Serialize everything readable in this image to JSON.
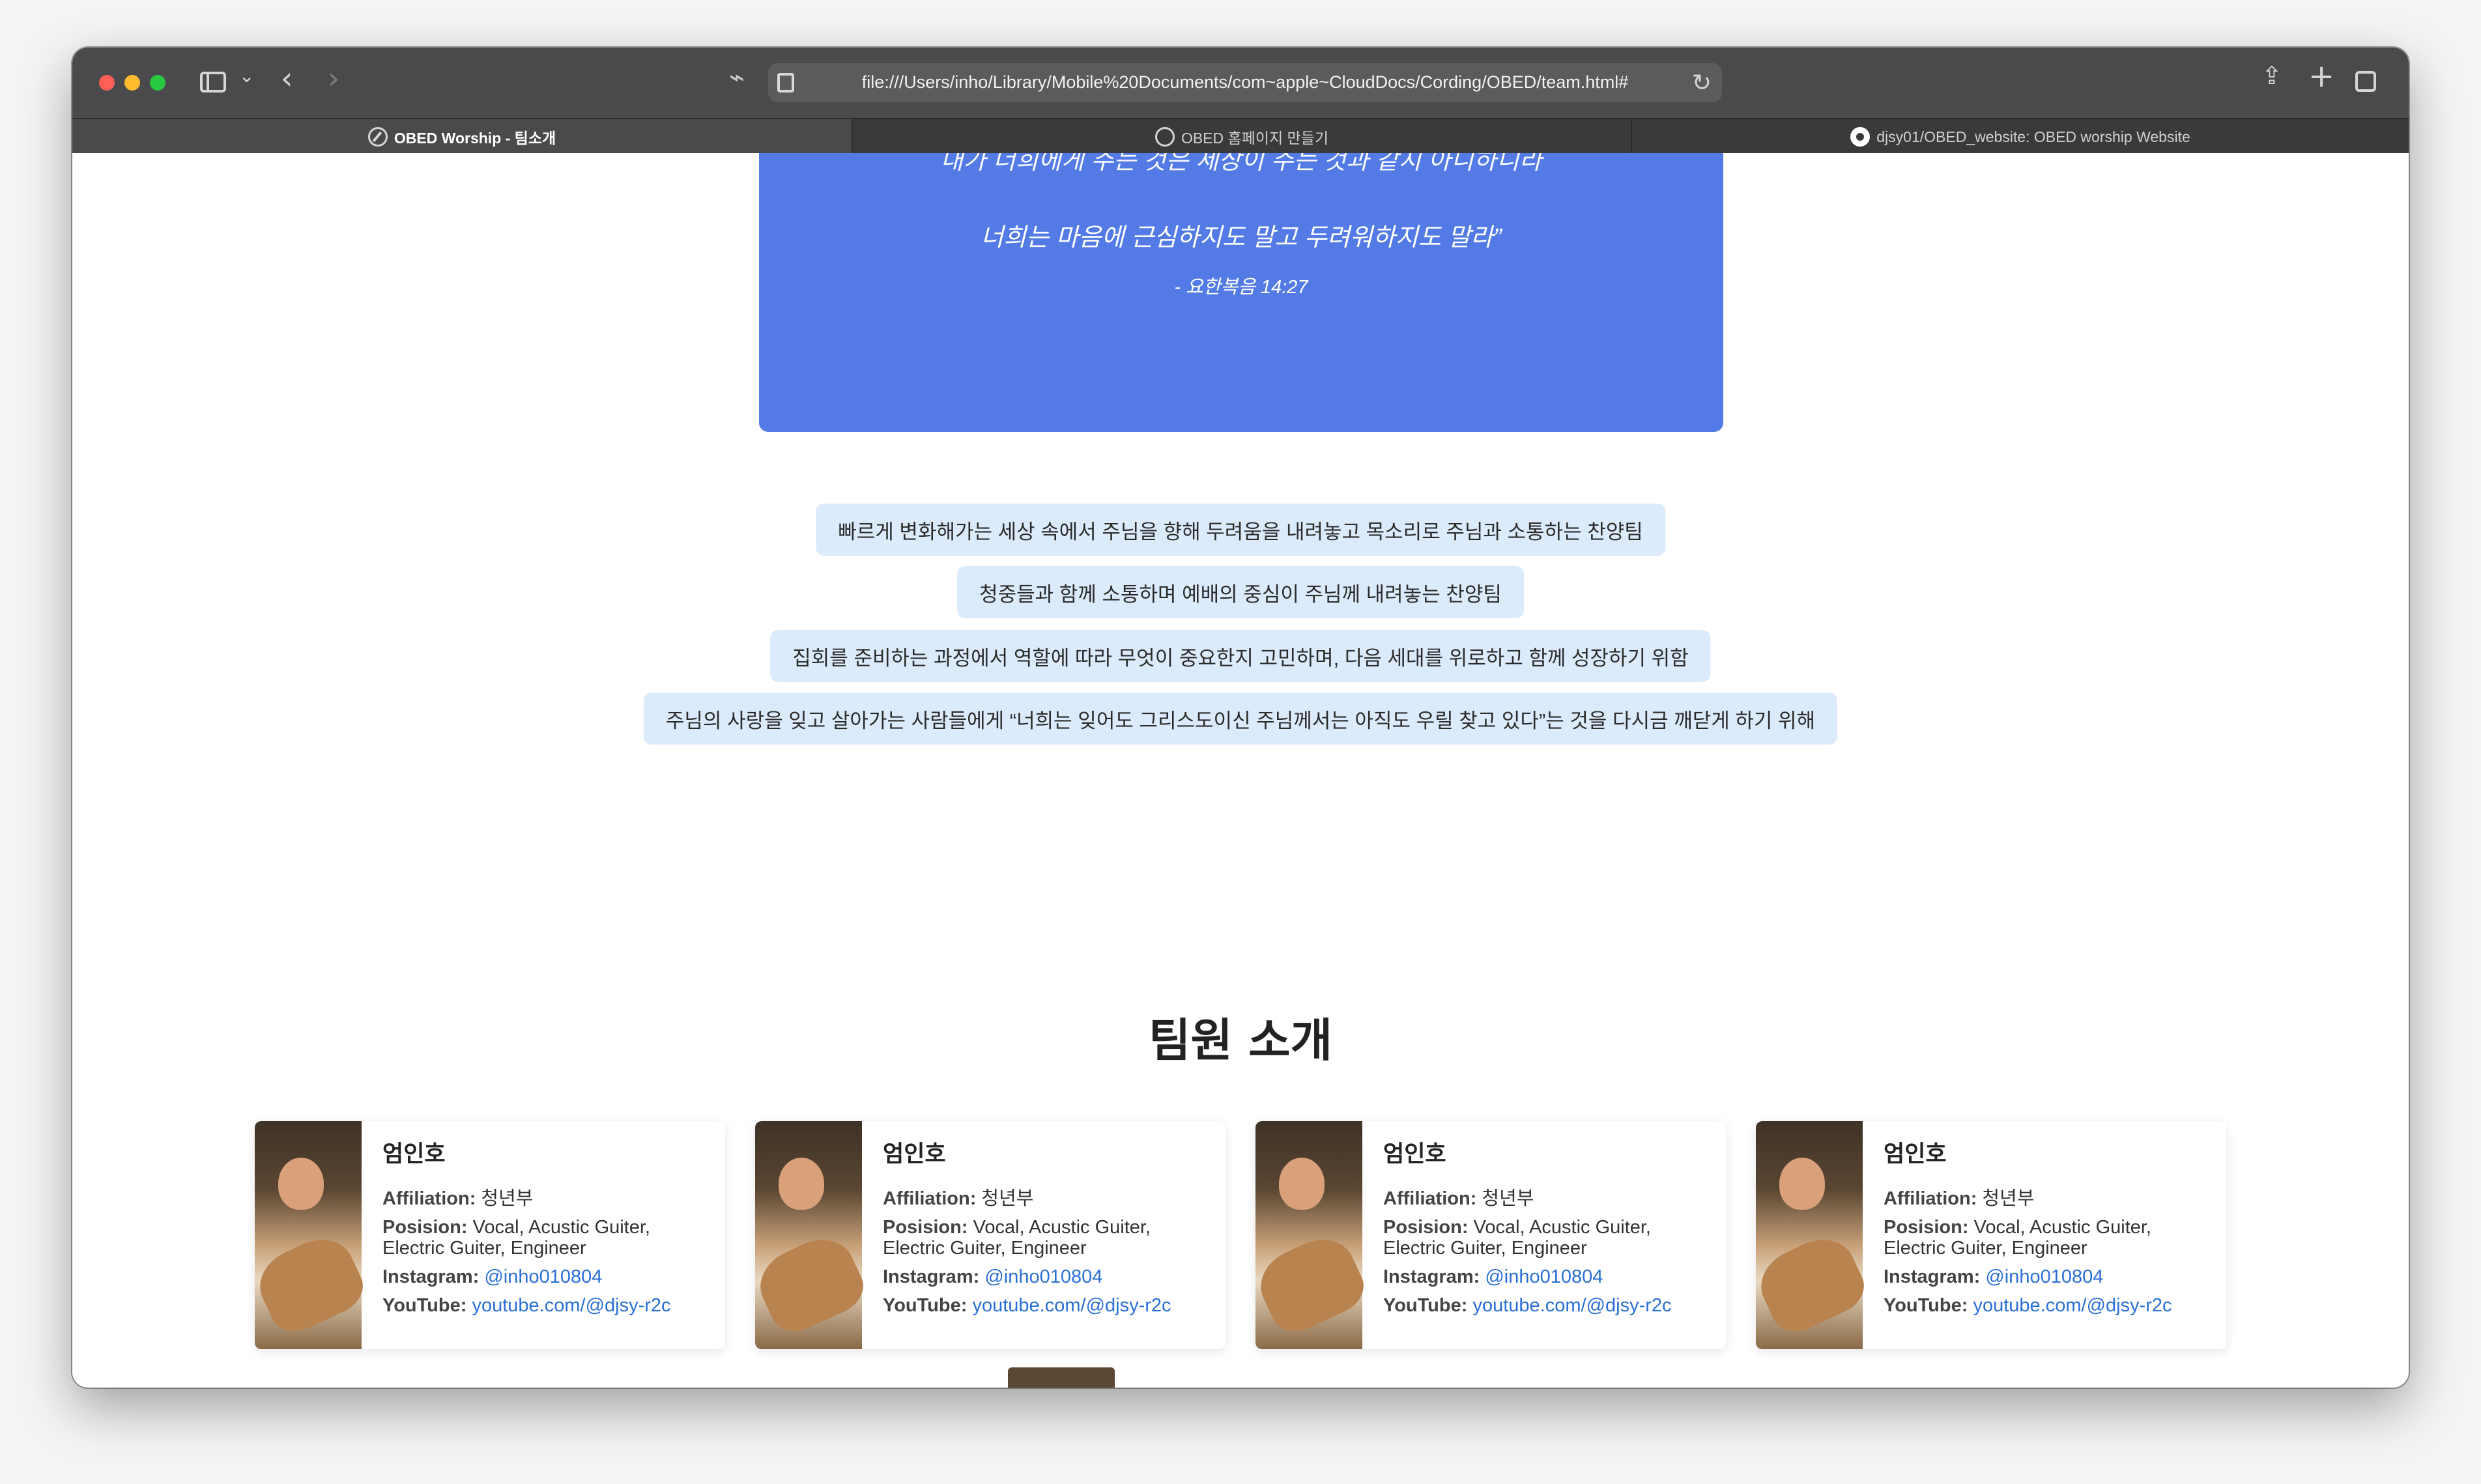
{
  "browser": {
    "url": "file:///Users/inho/Library/Mobile%20Documents/com~apple~CloudDocs/Cording/OBED/team.html#",
    "tabs": [
      {
        "label": "OBED Worship - 팀소개",
        "active": true
      },
      {
        "label": "OBED 홈페이지 만들기",
        "active": false
      },
      {
        "label": "djsy01/OBED_website: OBED worship Website",
        "active": false
      }
    ]
  },
  "verse": {
    "line1": "내가 너희에게 주는 것은 세상이 주는 것과 같지 아니하니라",
    "line2": "너희는 마음에 근심하지도 말고 두려워하지도 말라”",
    "reference": "- 요한복음 14:27"
  },
  "mission": [
    "빠르게 변화해가는 세상 속에서 주님을 향해 두려움을 내려놓고 목소리로 주님과 소통하는 찬양팀",
    "청중들과 함께 소통하며 예배의 중심이 주님께 내려놓는 찬양팀",
    "집회를 준비하는 과정에서 역할에 따라 무엇이 중요한지 고민하며, 다음 세대를 위로하고 함께 성장하기 위함",
    "주님의 사랑을 잊고 살아가는 사람들에게 “너희는 잊어도 그리스도이신 주님께서는 아직도 우릴 찾고 있다”는 것을 다시금 깨닫게 하기 위해"
  ],
  "team_section": {
    "title": "팀원 소개",
    "labels": {
      "affiliation": "Affiliation:",
      "position": "Posision:",
      "instagram": "Instagram:",
      "youtube": "YouTube:"
    },
    "members": [
      {
        "name": "엄인호",
        "affiliation": "청년부",
        "position": "Vocal, Acustic Guiter, Electric Guiter, Engineer",
        "instagram": "@inho010804",
        "youtube": "youtube.com/@djsy-r2c"
      },
      {
        "name": "엄인호",
        "affiliation": "청년부",
        "position": "Vocal, Acustic Guiter, Electric Guiter, Engineer",
        "instagram": "@inho010804",
        "youtube": "youtube.com/@djsy-r2c"
      },
      {
        "name": "엄인호",
        "affiliation": "청년부",
        "position": "Vocal, Acustic Guiter, Electric Guiter, Engineer",
        "instagram": "@inho010804",
        "youtube": "youtube.com/@djsy-r2c"
      },
      {
        "name": "엄인호",
        "affiliation": "청년부",
        "position": "Vocal, Acustic Guiter, Electric Guiter, Engineer",
        "instagram": "@inho010804",
        "youtube": "youtube.com/@djsy-r2c"
      }
    ]
  },
  "icons": {
    "sidebar": "sidebar-icon",
    "back": "chevron-left-icon",
    "forward": "chevron-right-icon",
    "reload": "reload-icon",
    "share": "share-icon",
    "new_tab": "plus-icon",
    "tab_overview": "tabs-icon"
  },
  "colors": {
    "verse_bg": "#547be5",
    "mission_bg": "#dcebfb",
    "link": "#2a6fd6",
    "toolbar": "#4a4a4c"
  }
}
